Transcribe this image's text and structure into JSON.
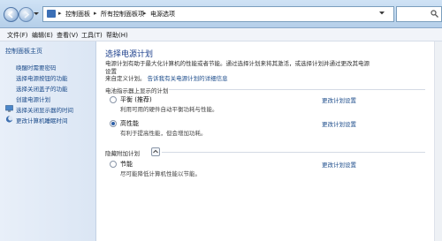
{
  "address": {
    "crumbs": [
      "控制面板",
      "所有控制面板项",
      "电源选项"
    ],
    "search_placeholder": ""
  },
  "menu": {
    "items": [
      "文件(F)",
      "编辑(E)",
      "查看(V)",
      "工具(T)",
      "帮助(H)"
    ]
  },
  "sidebar": {
    "home": "控制面板主页",
    "links": [
      "唤醒时需要密码",
      "选择电源按钮的功能",
      "选择关闭盖子的功能",
      "创建电源计划",
      "选择关闭显示器的时间",
      "更改计算机睡眠时间"
    ]
  },
  "main": {
    "title": "选择电源计划",
    "intro_line1": "电源计划有助于最大化计算机的性能或者节能。通过选择计划来将其激活，或选择计划并通过更改其电源设置",
    "intro_line2_prefix": "来自定义计划。",
    "intro_link": "告诉我有关电源计划的详细信息",
    "section_shown": "电池指示器上显示的计划",
    "section_hidden": "隐藏附加计划",
    "plans": [
      {
        "name": "平衡 (推荐)",
        "desc": "利用可用的硬件自动平衡功耗与性能。",
        "link": "更改计划设置",
        "checked": false
      },
      {
        "name": "高性能",
        "desc": "有利于提高性能，但会增加功耗。",
        "link": "更改计划设置",
        "checked": true
      },
      {
        "name": "节能",
        "desc": "尽可能降低计算机性能以节能。",
        "link": "更改计划设置",
        "checked": false
      }
    ]
  }
}
